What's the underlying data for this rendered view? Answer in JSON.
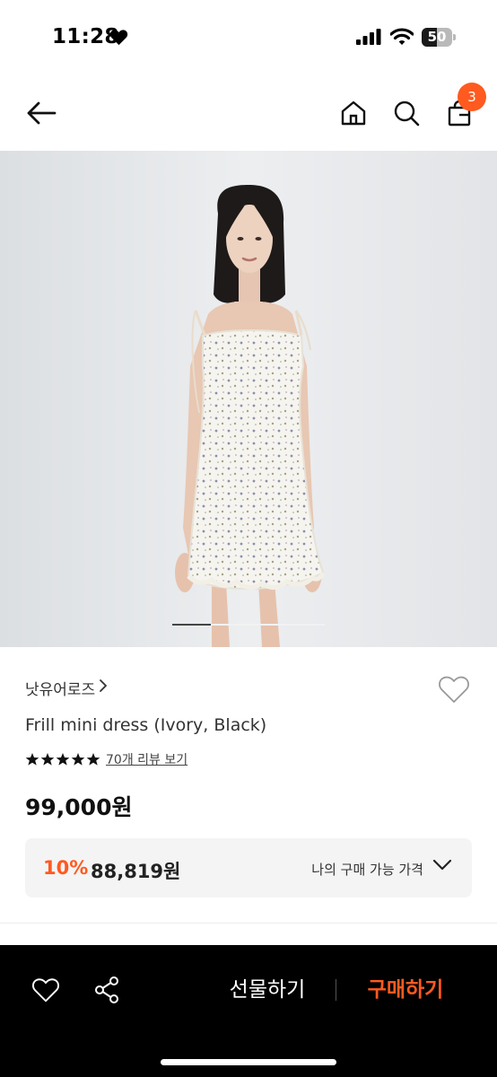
{
  "status_bar": {
    "time": "11:28",
    "battery_level": "50",
    "battery_fraction": 0.5
  },
  "top_nav": {
    "cart_count": "3"
  },
  "product": {
    "image_count_progress": 0.25,
    "brand": "낫유어로즈",
    "title": "Frill mini dress (Ivory, Black)",
    "rating_stars": 5,
    "review_link": "70개 리뷰 보기",
    "price": "99,000원",
    "my_price": {
      "discount_rate": "10%",
      "discounted_price": "88,819원",
      "label": "나의 구매 가능 가격"
    }
  },
  "bottom_bar": {
    "gift_label": "선물하기",
    "buy_label": "구매하기"
  },
  "colors": {
    "accent": "#ff5a1f",
    "bar_bg": "#000000"
  },
  "icons": [
    "heart-icon",
    "signal-icon",
    "wifi-icon",
    "battery-icon",
    "back-arrow-icon",
    "home-icon",
    "search-icon",
    "shopping-bag-icon",
    "chevron-right-icon",
    "heart-outline-icon",
    "star-icon",
    "chevron-down-icon",
    "share-icon"
  ]
}
